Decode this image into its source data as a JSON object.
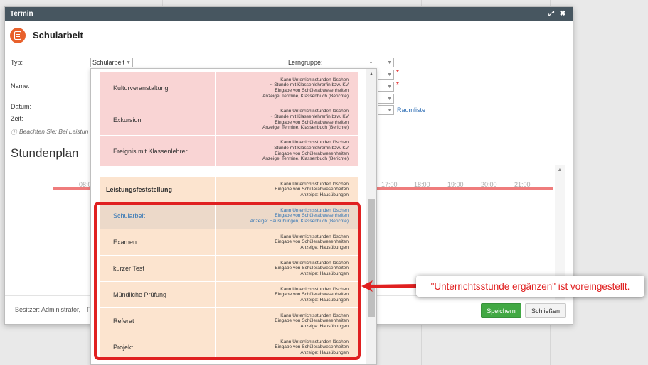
{
  "dialog": {
    "title": "Termin",
    "header_title": "Schularbeit"
  },
  "form": {
    "typ_label": "Typ:",
    "typ_value": "Schularbeit",
    "lerngruppe_label": "Lerngruppe:",
    "lerngruppe_value": "-",
    "name_label": "Name:",
    "datum_label": "Datum:",
    "zeit_label": "Zeit:",
    "raumliste_link": "Raumliste",
    "note": "Beachten Sie: Bei Leistun",
    "required_mark": "*"
  },
  "stundenplan": {
    "title": "Stundenplan",
    "ticks": [
      "08:0",
      "17:00",
      "18:00",
      "19:00",
      "20:00",
      "21:00"
    ]
  },
  "dropdown": {
    "rows": [
      {
        "name": "Kulturveranstaltung",
        "style": "pink",
        "desc": [
          "Kann Unterrichtsstunden löschen",
          "~ Stunde mit Klassenlehrer/in bzw. KV",
          "Eingabe von Schülerabwesenheiten",
          "Anzeige: Termine, Klassenbuch (Berichte)"
        ]
      },
      {
        "name": "Exkursion",
        "style": "pink",
        "desc": [
          "Kann Unterrichtsstunden löschen",
          "~ Stunde mit Klassenlehrer/in bzw. KV",
          "Eingabe von Schülerabwesenheiten",
          "Anzeige: Termine, Klassenbuch (Berichte)"
        ]
      },
      {
        "name": "Ereignis mit Klassenlehrer",
        "style": "pink",
        "desc": [
          "Kann Unterrichtsstunden löschen",
          "Stunde mit Klassenlehrer/in bzw. KV",
          "Eingabe von Schülerabwesenheiten",
          "Anzeige: Termine, Klassenbuch (Berichte)"
        ]
      },
      {
        "name": "Leistungsfeststellung",
        "style": "group",
        "desc": [
          "Kann Unterrichtsstunden löschen",
          "Eingabe von Schülerabwesenheiten",
          "Anzeige: Hausübungen"
        ]
      },
      {
        "name": "Schularbeit",
        "style": "selected",
        "desc": [
          "Kann Unterrichtsstunden löschen",
          "Eingabe von Schülerabwesenheiten",
          "Anzeige: Hausübungen, Klassenbuch (Berichte)"
        ]
      },
      {
        "name": "Examen",
        "style": "peach",
        "desc": [
          "Kann Unterrichtsstunden löschen",
          "Eingabe von Schülerabwesenheiten",
          "Anzeige: Hausübungen"
        ]
      },
      {
        "name": "kurzer Test",
        "style": "peach",
        "desc": [
          "Kann Unterrichtsstunden löschen",
          "Eingabe von Schülerabwesenheiten",
          "Anzeige: Hausübungen"
        ]
      },
      {
        "name": "Mündliche Prüfung",
        "style": "peach",
        "desc": [
          "Kann Unterrichtsstunden löschen",
          "Eingabe von Schülerabwesenheiten",
          "Anzeige: Hausübungen"
        ]
      },
      {
        "name": "Referat",
        "style": "peach",
        "desc": [
          "Kann Unterrichtsstunden löschen",
          "Eingabe von Schülerabwesenheiten",
          "Anzeige: Hausübungen"
        ]
      },
      {
        "name": "Projekt",
        "style": "peach",
        "desc": [
          "Kann Unterrichtsstunden löschen",
          "Eingabe von Schülerabwesenheiten",
          "Anzeige: Hausübungen"
        ]
      }
    ]
  },
  "footer": {
    "owner": "Besitzer: Administrator,",
    "owner_cut": "F",
    "save_label": "Speichern",
    "close_label": "Schließen"
  },
  "callout": {
    "text": "\"Unterrichtsstunde ergänzen\" ist voreingestellt."
  },
  "colors": {
    "titlebar": "#475660",
    "accent": "#e8612c",
    "save": "#41a843",
    "highlight": "#e02020",
    "pink_row": "#f9d4d4",
    "peach_row": "#fce4cf"
  }
}
